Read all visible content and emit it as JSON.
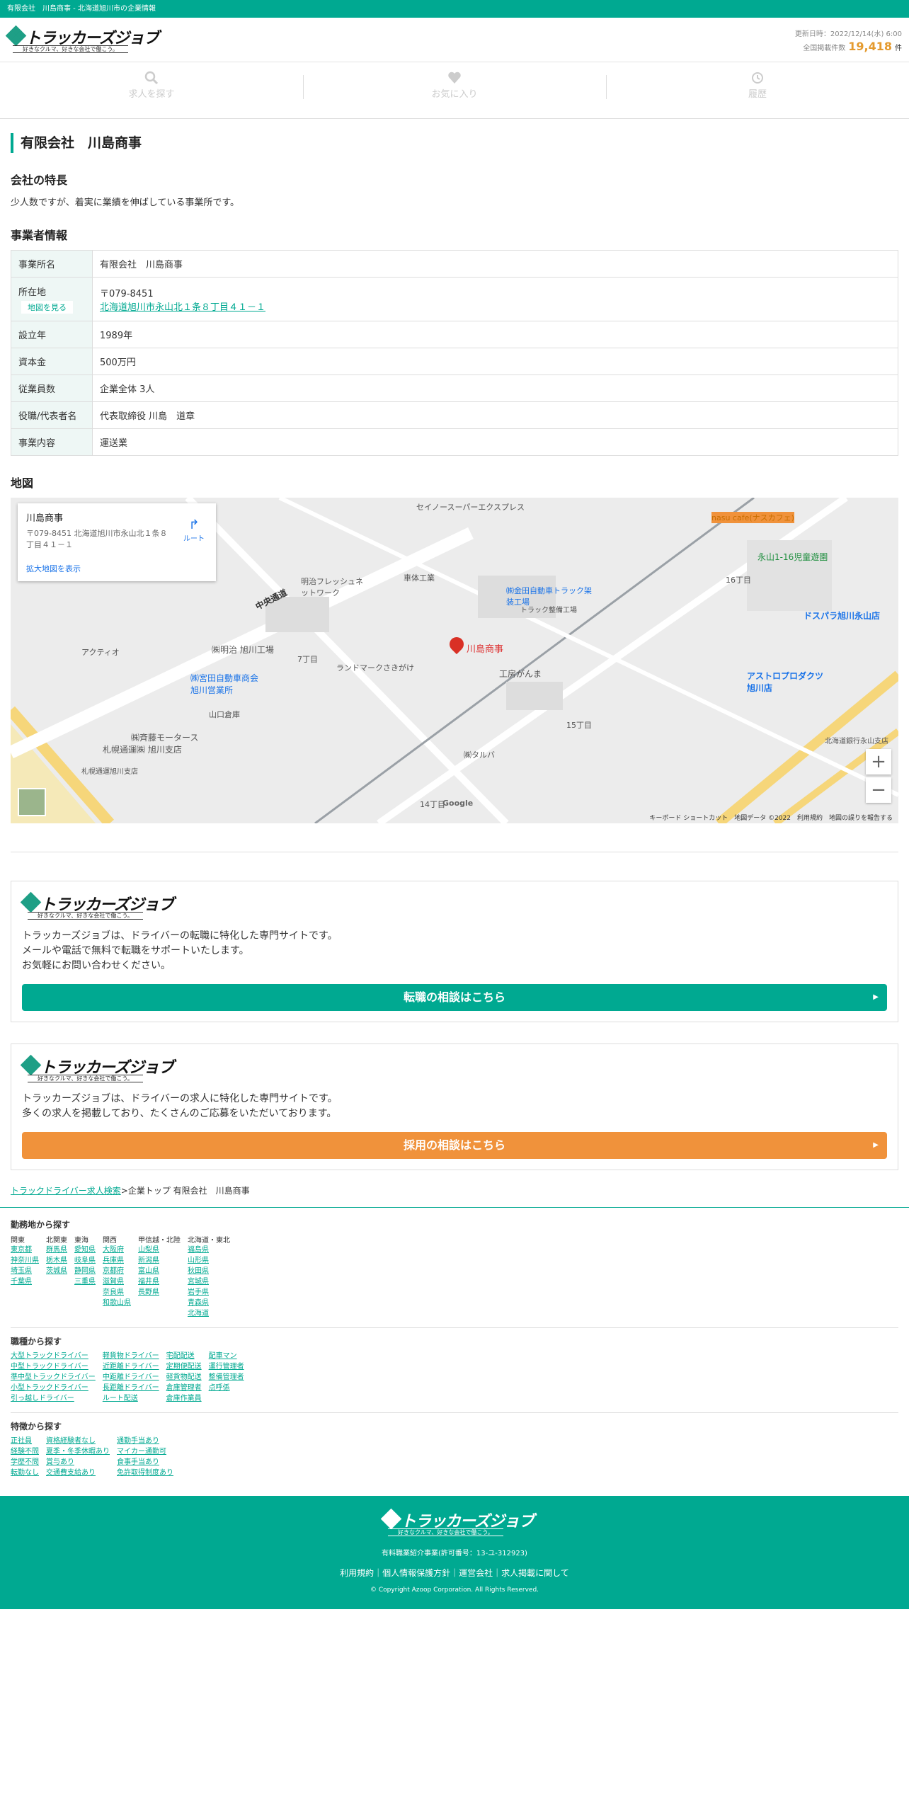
{
  "topbar": {
    "text": "有限会社　川島商事 - 北海道旭川市の企業情報"
  },
  "brand": {
    "name": "トラッカーズジョブ",
    "tagline": "好きなクルマ、好きな会社で働こう。"
  },
  "header": {
    "updated": "更新日時：2022/12/14(水) 6:00",
    "count_label": "全国掲載件数",
    "count": "19,418",
    "count_unit": "件"
  },
  "nav": [
    {
      "label": "求人を探す",
      "icon": "search-icon"
    },
    {
      "label": "お気に入り",
      "icon": "heart-icon"
    },
    {
      "label": "履歴",
      "icon": "history-icon"
    }
  ],
  "company": {
    "name": "有限会社　川島商事",
    "feature_heading": "会社の特長",
    "feature_text": "少人数ですが、着実に業績を伸ばしている事業所です。",
    "info_heading": "事業者情報",
    "rows": {
      "office": {
        "label": "事業所名",
        "value": "有限会社　川島商事"
      },
      "location": {
        "label": "所在地",
        "map_button": "地図を見る",
        "zip": "〒079-8451",
        "address": "北海道旭川市永山北１条８丁目４１－１"
      },
      "founded": {
        "label": "設立年",
        "value": "1989年"
      },
      "capital": {
        "label": "資本金",
        "value": "500万円"
      },
      "employees": {
        "label": "従業員数",
        "value": "企業全体 3人"
      },
      "representative": {
        "label": "役職/代表者名",
        "value": "代表取締役 川島　道章"
      },
      "business": {
        "label": "事業内容",
        "value": "運送業"
      }
    },
    "map_heading": "地図"
  },
  "map": {
    "card_name": "川島商事",
    "card_address": "〒079-8451 北海道旭川市永山北１条８丁目４１－１",
    "card_zoom": "拡大地図を表示",
    "card_route": "ルート",
    "labels": {
      "marker": "川島商事",
      "seiko": "セイノースーパーエクスプレス",
      "toraku": "㈱金田自動車トラック架装工場",
      "toraku_sub": "トラック整備工場",
      "meiji": "㈱明治 旭川工場",
      "miyata": "㈱宮田自動車商会 旭川営業所",
      "saito": "㈱斉藤モータース",
      "sapporo": "札幌通運㈱ 旭川支店",
      "sapporo2": "札幌通運旭川支店",
      "chuo": "中央通道",
      "nasu": "nasu cafe(ナスカフェ)",
      "park": "永山1-16児童遊園",
      "dosu": "ドスパラ旭川永山店",
      "astro": "アストロプロダクツ 旭川店",
      "kobo": "工房がんま",
      "taruba": "㈱タルバ",
      "landmark": "ランドマークさきがけ",
      "meiji_fresh": "明治フレッシュネットワーク",
      "yamaguchi": "山口倉庫",
      "acty": "アクティオ",
      "sharen": "車体工業",
      "bank": "北海道銀行永山支店",
      "chome16": "16丁目",
      "chome15": "15丁目",
      "chome14": "14丁目",
      "chome7": "7丁目"
    },
    "footer": "キーボード ショートカット　地図データ ©2022　利用規約　地図の誤りを報告する",
    "google": "Google"
  },
  "promo1": {
    "text": [
      "トラッカーズジョブは、ドライバーの転職に特化した専門サイトです。",
      "メールや電話で無料で転職をサポートいたします。",
      "お気軽にお問い合わせください。"
    ],
    "cta": "転職の相談はこちら"
  },
  "promo2": {
    "text": [
      "トラッカーズジョブは、ドライバーの求人に特化した専門サイトです。",
      "多くの求人を掲載しており、たくさんのご応募をいただいております。"
    ],
    "cta": "採用の相談はこちら"
  },
  "breadcrumb": {
    "link": "トラックドライバー求人検索",
    "sep": ">",
    "rest": "企業トップ 有限会社　川島商事"
  },
  "footer_links": {
    "area_heading": "勤務地から探す",
    "areas": [
      {
        "head": "関東",
        "items": [
          "東京都",
          "神奈川県",
          "埼玉県",
          "千葉県"
        ]
      },
      {
        "head": "北関東",
        "items": [
          "群馬県",
          "栃木県",
          "茨城県"
        ]
      },
      {
        "head": "東海",
        "items": [
          "愛知県",
          "岐阜県",
          "静岡県",
          "三重県"
        ]
      },
      {
        "head": "関西",
        "items": [
          "大阪府",
          "兵庫県",
          "京都府",
          "滋賀県",
          "奈良県",
          "和歌山県"
        ]
      },
      {
        "head": "甲信越・北陸",
        "items": [
          "山梨県",
          "新潟県",
          "富山県",
          "福井県",
          "長野県"
        ]
      },
      {
        "head": "北海道・東北",
        "items": [
          "福島県",
          "山形県",
          "秋田県",
          "宮城県",
          "岩手県",
          "青森県",
          "北海道"
        ]
      }
    ],
    "job_heading": "職種から探す",
    "jobs": [
      [
        "大型トラックドライバー",
        "中型トラックドライバー",
        "準中型トラックドライバー",
        "小型トラックドライバー",
        "引っ越しドライバー"
      ],
      [
        "軽貨物ドライバー",
        "近距離ドライバー",
        "中距離ドライバー",
        "長距離ドライバー",
        "ルート配送"
      ],
      [
        "宅配配送",
        "定期便配送",
        "軽貨物配送",
        "倉庫管理者",
        "倉庫作業員"
      ],
      [
        "配車マン",
        "運行管理者",
        "整備管理者",
        "点呼係"
      ]
    ],
    "feature_heading": "特徴から探す",
    "features": [
      [
        "正社員",
        "経験不問",
        "学歴不問",
        "転勤なし"
      ],
      [
        "資格経験者なし",
        "夏季・冬季休暇あり",
        "賞与あり",
        "交通費支給あり"
      ],
      [
        "通勤手当あり",
        "マイカー通勤可",
        "食事手当あり",
        "免許取得制度あり"
      ]
    ]
  },
  "site_footer": {
    "license": "有料職業紹介事業(許可番号：13-ユ-312923)",
    "links": "利用規約｜個人情報保護方針｜運営会社｜求人掲載に関して",
    "copyright": "© Copyright Azoop Corporation. All Rights Reserved."
  },
  "colors": {
    "primary": "#00a991",
    "accent": "#f0923b",
    "count": "#e49a2e"
  }
}
